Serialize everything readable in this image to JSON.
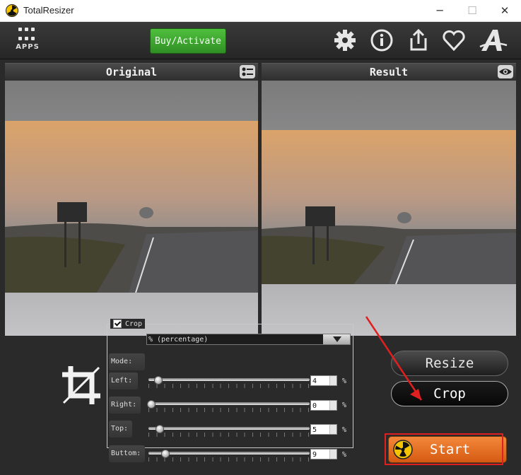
{
  "window": {
    "title": "TotalResizer",
    "minimize_glyph": "─",
    "maximize_glyph": "☐",
    "close_glyph": "✕"
  },
  "toolbar": {
    "apps_label": "APPS",
    "buy_label": "Buy/Activate",
    "icons": [
      "gear-icon",
      "info-icon",
      "share-icon",
      "heart-icon",
      "font-a-icon"
    ]
  },
  "panels": {
    "original_title": "Original",
    "result_title": "Result",
    "original_icon": "view-list-icon",
    "result_icon": "eye-icon"
  },
  "crop": {
    "enabled_label": "Crop",
    "mode_label": "Mode:",
    "mode_value": "% (percentage)",
    "unit": "%",
    "rows": [
      {
        "label": "Left:",
        "value": "4"
      },
      {
        "label": "Right:",
        "value": "0"
      },
      {
        "label": "Top:",
        "value": "5"
      },
      {
        "label": "Buttom:",
        "value": "9"
      }
    ]
  },
  "actions": {
    "resize_label": "Resize",
    "crop_label": "Crop",
    "start_label": "Start"
  },
  "colors": {
    "buy_green": "#3aa82c",
    "start_orange": "#e86f22",
    "highlight_red": "#e02020"
  }
}
